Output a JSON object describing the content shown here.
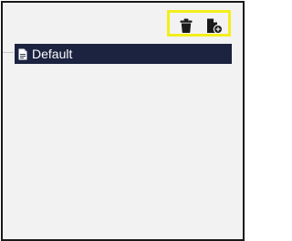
{
  "toolbar": {
    "delete_icon": "trash-icon",
    "add_icon": "add-document-icon",
    "highlight_color": "#f3ee1b"
  },
  "list": {
    "items": [
      {
        "label": "Default",
        "icon": "document-icon",
        "selected": true
      }
    ],
    "selected_bg": "#1b2340"
  }
}
